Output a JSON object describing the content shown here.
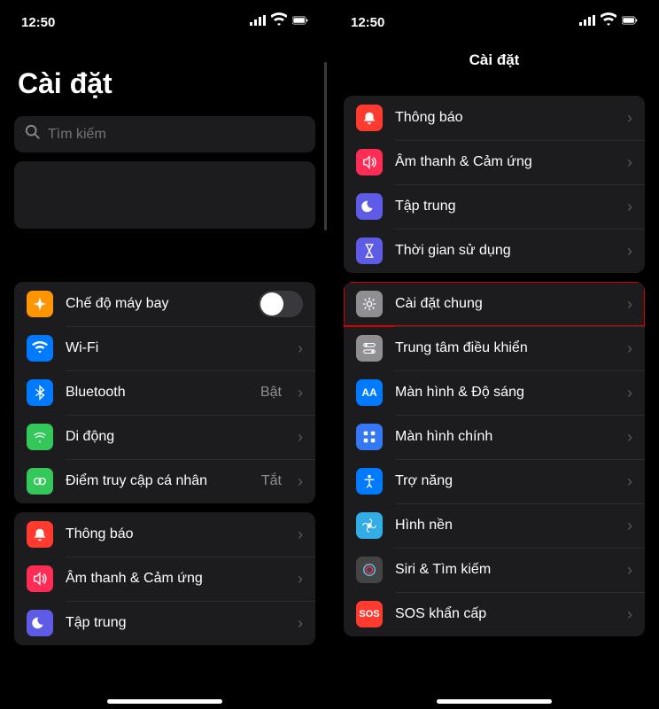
{
  "status": {
    "time": "12:50"
  },
  "left": {
    "title": "Cài đặt",
    "search_placeholder": "Tìm kiếm",
    "groups": [
      {
        "rows": [
          {
            "icon": "airplane",
            "color": "ic-orange",
            "label": "Chế độ máy bay",
            "toggle": false
          },
          {
            "icon": "wifi",
            "color": "ic-blue",
            "label": "Wi-Fi",
            "chevron": true
          },
          {
            "icon": "bluetooth",
            "color": "ic-blue",
            "label": "Bluetooth",
            "value": "Bật",
            "chevron": true
          },
          {
            "icon": "cellular",
            "color": "ic-green",
            "label": "Di động",
            "chevron": true
          },
          {
            "icon": "hotspot",
            "color": "ic-green",
            "label": "Điểm truy cập cá nhân",
            "value": "Tắt",
            "chevron": true
          }
        ]
      },
      {
        "rows": [
          {
            "icon": "bell",
            "color": "ic-red",
            "label": "Thông báo",
            "chevron": true
          },
          {
            "icon": "speaker",
            "color": "ic-pink",
            "label": "Âm thanh & Cảm ứng",
            "chevron": true
          },
          {
            "icon": "moon",
            "color": "ic-indigo",
            "label": "Tập trung",
            "chevron": true
          }
        ]
      }
    ]
  },
  "right": {
    "title": "Cài đặt",
    "groups": [
      {
        "rows": [
          {
            "icon": "bell",
            "color": "ic-red",
            "label": "Thông báo",
            "chevron": true
          },
          {
            "icon": "speaker",
            "color": "ic-pink",
            "label": "Âm thanh & Cảm ứng",
            "chevron": true
          },
          {
            "icon": "moon",
            "color": "ic-indigo",
            "label": "Tập trung",
            "chevron": true
          },
          {
            "icon": "hourglass",
            "color": "ic-indigo",
            "label": "Thời gian sử dụng",
            "chevron": true
          }
        ]
      },
      {
        "rows": [
          {
            "icon": "gear",
            "color": "ic-gray",
            "label": "Cài đặt chung",
            "chevron": true,
            "highlight": true
          },
          {
            "icon": "switches",
            "color": "ic-gray",
            "label": "Trung tâm điều khiển",
            "chevron": true
          },
          {
            "icon": "aa",
            "color": "ic-blue",
            "label": "Màn hình & Độ sáng",
            "chevron": true
          },
          {
            "icon": "grid",
            "color": "ic-darkblue",
            "label": "Màn hình chính",
            "chevron": true
          },
          {
            "icon": "person",
            "color": "ic-blue",
            "label": "Trợ năng",
            "chevron": true
          },
          {
            "icon": "flower",
            "color": "ic-cyan",
            "label": "Hình nền",
            "chevron": true
          },
          {
            "icon": "siri",
            "color": "ic-black",
            "label": "Siri & Tìm kiếm",
            "chevron": true
          },
          {
            "icon": "sos",
            "color": "ic-redsos",
            "label": "SOS khẩn cấp",
            "chevron": true
          }
        ]
      }
    ]
  }
}
